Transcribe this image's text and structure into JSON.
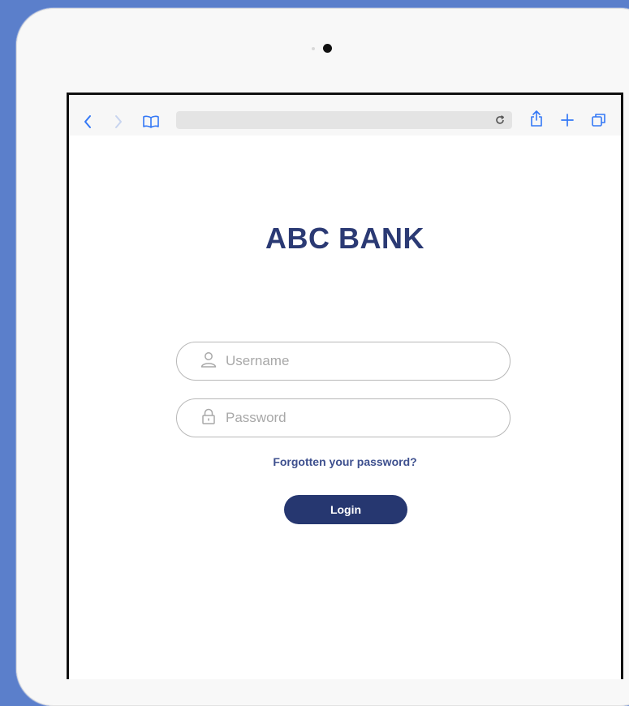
{
  "brand": {
    "name": "ABC BANK",
    "color": "#2b3a74"
  },
  "browser": {
    "icons": [
      "back-icon",
      "forward-icon",
      "bookmarks-icon",
      "reload-icon",
      "share-icon",
      "new-tab-icon",
      "tabs-icon"
    ],
    "accent": "#3478f6"
  },
  "login": {
    "username_placeholder": "Username",
    "password_placeholder": "Password",
    "forgot_label": "Forgotten your password?",
    "login_label": "Login",
    "button_color": "#263770"
  }
}
